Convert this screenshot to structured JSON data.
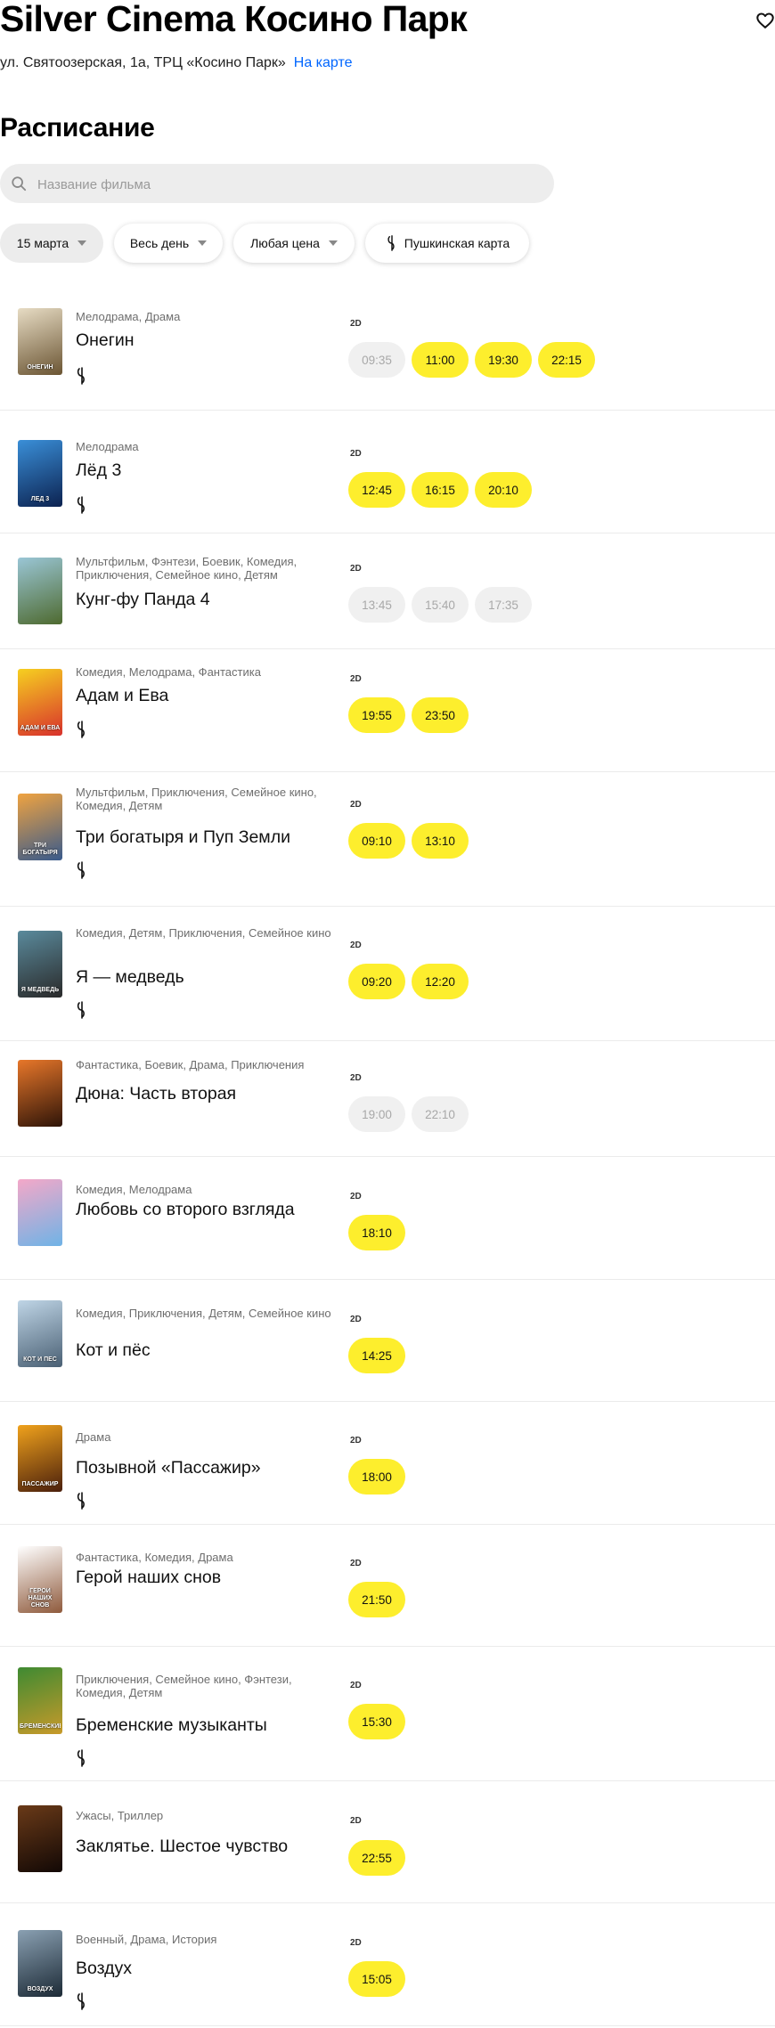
{
  "cinema": {
    "name": "Silver Cinema Косино Парк",
    "address": "ул. Святоозерская, 1а, ТРЦ «Косино Парк»",
    "map_link": "На карте"
  },
  "schedule_heading": "Расписание",
  "search": {
    "placeholder": "Название фильма",
    "value": ""
  },
  "filters": [
    {
      "label": "15 марта",
      "active": true,
      "icon": "caret-down-icon"
    },
    {
      "label": "Весь день",
      "active": false,
      "icon": "caret-down-icon"
    },
    {
      "label": "Любая цена",
      "active": false,
      "icon": "caret-down-icon"
    },
    {
      "label": "Пушкинская карта",
      "active": false,
      "icon": "pushkin-card-icon"
    }
  ],
  "colors": {
    "accent": "#fdee2d",
    "link": "#0066ff",
    "past_session": "#f0f0f0"
  },
  "movies": [
    {
      "genres": "Мелодрама, Драма",
      "title": "Онегин",
      "pushkin": true,
      "format": "2D",
      "poster_colors": [
        "#e7dcc4",
        "#6b5533"
      ],
      "poster_text": "Онегин",
      "sessions": [
        {
          "time": "09:35",
          "past": true
        },
        {
          "time": "11:00",
          "past": false
        },
        {
          "time": "19:30",
          "past": false
        },
        {
          "time": "22:15",
          "past": false
        }
      ]
    },
    {
      "genres": "Мелодрама",
      "title": "Лёд 3",
      "pushkin": true,
      "format": "2D",
      "poster_colors": [
        "#3a8fd8",
        "#0c2250"
      ],
      "poster_text": "Лёд 3",
      "sessions": [
        {
          "time": "12:45",
          "past": false
        },
        {
          "time": "16:15",
          "past": false
        },
        {
          "time": "20:10",
          "past": false
        }
      ]
    },
    {
      "genres": "Мультфильм, Фэнтези, Боевик, Комедия, Приключения, Семейное кино, Детям",
      "title": "Кунг-фу Панда 4",
      "pushkin": false,
      "format": "2D",
      "poster_colors": [
        "#9ac6d6",
        "#4e6a2f"
      ],
      "poster_text": "",
      "sessions": [
        {
          "time": "13:45",
          "past": true
        },
        {
          "time": "15:40",
          "past": true
        },
        {
          "time": "17:35",
          "past": true
        }
      ]
    },
    {
      "genres": "Комедия, Мелодрама, Фантастика",
      "title": "Адам и Ева",
      "pushkin": true,
      "format": "2D",
      "poster_colors": [
        "#f6d020",
        "#d8312c"
      ],
      "poster_text": "Адам и Ева",
      "sessions": [
        {
          "time": "19:55",
          "past": false
        },
        {
          "time": "23:50",
          "past": false
        }
      ]
    },
    {
      "genres": "Мультфильм, Приключения, Семейное кино, Комедия, Детям",
      "title": "Три богатыря и Пуп Земли",
      "pushkin": true,
      "format": "2D",
      "poster_colors": [
        "#f0a340",
        "#385a8c"
      ],
      "poster_text": "Три богатыря",
      "sessions": [
        {
          "time": "09:10",
          "past": false
        },
        {
          "time": "13:10",
          "past": false
        }
      ]
    },
    {
      "genres": "Комедия, Детям, Приключения, Семейное кино",
      "title": "Я — медведь",
      "pushkin": true,
      "format": "2D",
      "poster_colors": [
        "#5a8a9c",
        "#2a2a2a"
      ],
      "poster_text": "Я медведь",
      "sessions": [
        {
          "time": "09:20",
          "past": false
        },
        {
          "time": "12:20",
          "past": false
        }
      ]
    },
    {
      "genres": "Фантастика, Боевик, Драма, Приключения",
      "title": "Дюна: Часть вторая",
      "pushkin": false,
      "format": "2D",
      "poster_colors": [
        "#e8772a",
        "#2e1408"
      ],
      "poster_text": "",
      "sessions": [
        {
          "time": "19:00",
          "past": true
        },
        {
          "time": "22:10",
          "past": true
        }
      ]
    },
    {
      "genres": "Комедия, Мелодрама",
      "title": "Любовь со второго взгляда",
      "pushkin": false,
      "format": "2D",
      "poster_colors": [
        "#f4a8c8",
        "#6fb3e6"
      ],
      "poster_text": "",
      "sessions": [
        {
          "time": "18:10",
          "past": false
        }
      ]
    },
    {
      "genres": "Комедия, Приключения, Детям, Семейное кино",
      "title": "Кот и пёс",
      "pushkin": false,
      "format": "2D",
      "poster_colors": [
        "#bfd5e6",
        "#4a6074"
      ],
      "poster_text": "Кот и пёс",
      "sessions": [
        {
          "time": "14:25",
          "past": false
        }
      ]
    },
    {
      "genres": "Драма",
      "title": "Позывной «Пассажир»",
      "pushkin": true,
      "format": "2D",
      "poster_colors": [
        "#f0a21c",
        "#4a1f0c"
      ],
      "poster_text": "Пассажир",
      "sessions": [
        {
          "time": "18:00",
          "past": false
        }
      ]
    },
    {
      "genres": "Фантастика, Комедия, Драма",
      "title": "Герой наших снов",
      "pushkin": false,
      "format": "2D",
      "poster_colors": [
        "#ffffff",
        "#8f5a3c"
      ],
      "poster_text": "Герой наших снов",
      "sessions": [
        {
          "time": "21:50",
          "past": false
        }
      ]
    },
    {
      "genres": "Приключения, Семейное кино, Фэнтези, Комедия, Детям",
      "title": "Бременские музыканты",
      "pushkin": true,
      "format": "2D",
      "poster_colors": [
        "#3e8a32",
        "#c89a2a"
      ],
      "poster_text": "Бременские",
      "sessions": [
        {
          "time": "15:30",
          "past": false
        }
      ]
    },
    {
      "genres": "Ужасы, Триллер",
      "title": "Заклятье. Шестое чувство",
      "pushkin": false,
      "format": "2D",
      "poster_colors": [
        "#6a3a18",
        "#120805"
      ],
      "poster_text": "",
      "sessions": [
        {
          "time": "22:55",
          "past": false
        }
      ]
    },
    {
      "genres": "Военный, Драма, История",
      "title": "Воздух",
      "pushkin": true,
      "format": "2D",
      "poster_colors": [
        "#8aa0b2",
        "#1c2a36"
      ],
      "poster_text": "Воздух",
      "sessions": [
        {
          "time": "15:05",
          "past": false
        }
      ]
    }
  ]
}
